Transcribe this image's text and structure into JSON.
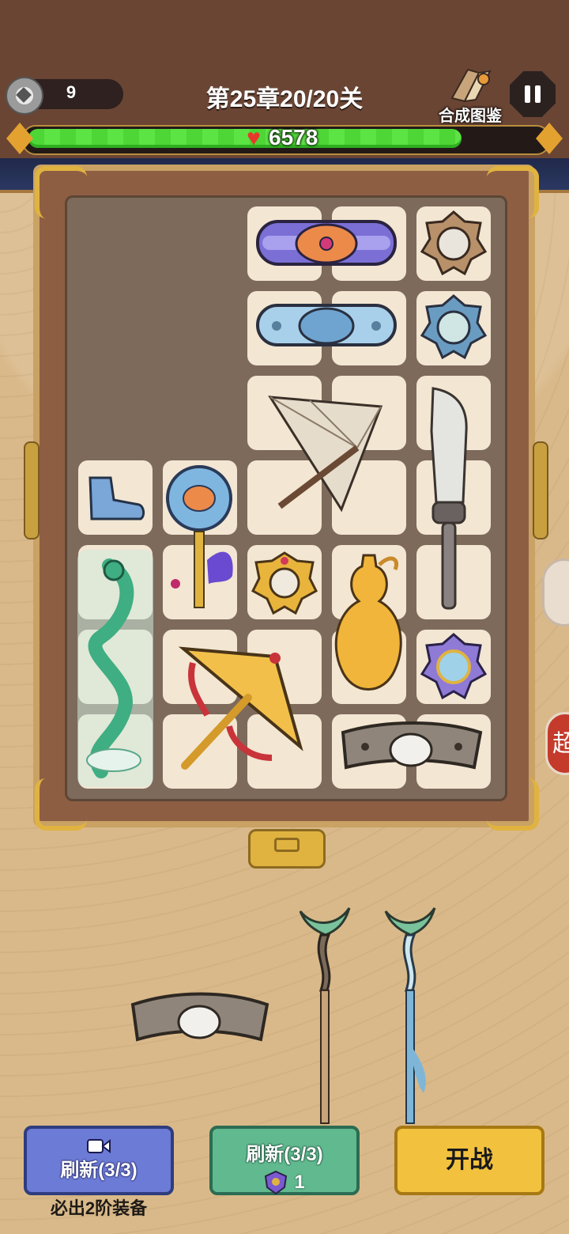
{
  "header": {
    "coins": "9",
    "chapter": "第25章20/20关",
    "codex_label": "合成图鉴"
  },
  "health": {
    "value": "6578",
    "fill_fraction": 0.83
  },
  "board": {
    "items": [
      {
        "name": "purple-flame-belt"
      },
      {
        "name": "gold-mirror-amulet"
      },
      {
        "name": "blue-cloud-belt"
      },
      {
        "name": "jade-lotus-amulet"
      },
      {
        "name": "paper-umbrella"
      },
      {
        "name": "broadsword"
      },
      {
        "name": "blue-boot"
      },
      {
        "name": "lotus-fan-scepter"
      },
      {
        "name": "gold-mirror-charm"
      },
      {
        "name": "golden-gourd"
      },
      {
        "name": "jade-dragon"
      },
      {
        "name": "golden-war-umbrella"
      },
      {
        "name": "purple-jade-amulet"
      },
      {
        "name": "grey-cloud-belt"
      }
    ]
  },
  "tray": {
    "items": [
      {
        "name": "grey-cloud-belt"
      },
      {
        "name": "wooden-spear"
      },
      {
        "name": "jade-spear"
      }
    ]
  },
  "buttons": {
    "ad_refresh_label": "刷新(3/3)",
    "ad_refresh_note": "必出2阶装备",
    "refresh_label": "刷新(3/3)",
    "refresh_cost": "1",
    "start_label": "开战"
  },
  "side": {
    "red_tab_label": "超"
  },
  "colors": {
    "top_bg": "#6a4534",
    "board_bg": "#7d6a5b",
    "cell": "#f3e6d2",
    "health": "#4ed636",
    "btn_blue": "#6c7bd6",
    "btn_green": "#61b98f",
    "btn_yellow": "#f2c23f"
  }
}
